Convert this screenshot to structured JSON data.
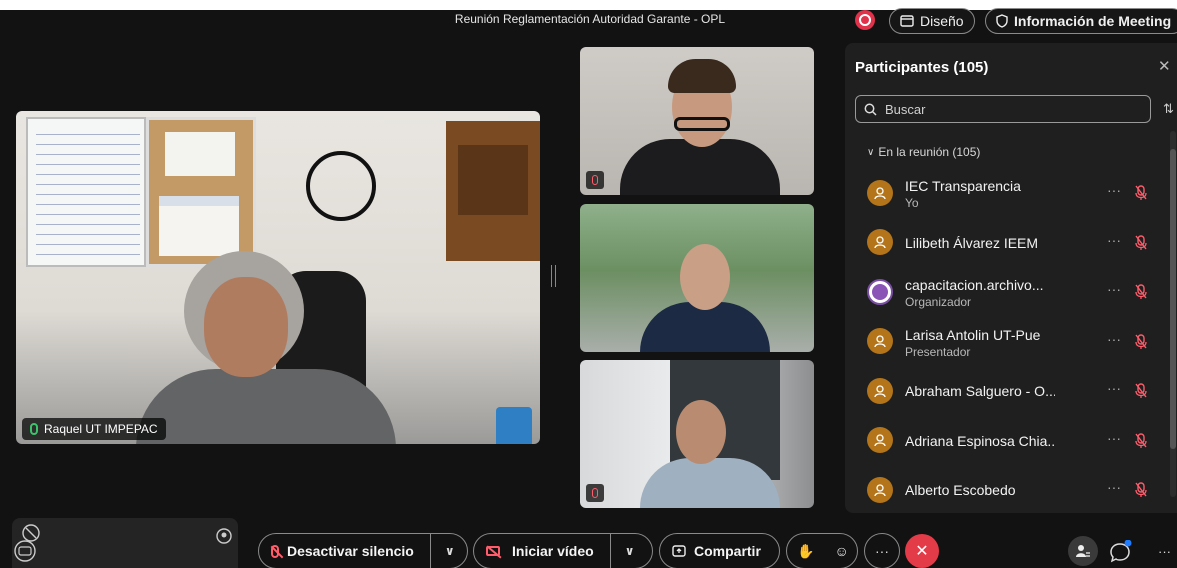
{
  "meeting": {
    "title": "Reunión Reglamentación Autoridad Garante - OPL"
  },
  "header": {
    "diseno_label": "Diseño",
    "info_label": "Información de Meeting",
    "record_color": "#e0324b"
  },
  "videos": {
    "main_name": "Raquel UT IMPEPAC"
  },
  "panel": {
    "title": "Participantes (105)",
    "search_placeholder": "Buscar",
    "section_label": "En la reunión (105)",
    "participants": [
      {
        "name": "IEC Transparencia",
        "role": "Yo",
        "avatar": "person-icon"
      },
      {
        "name": "Lilibeth Álvarez IEEM",
        "role": "",
        "avatar": "person-icon"
      },
      {
        "name": "capacitacion.archivo...",
        "role": "Organizador",
        "avatar": "profile-image"
      },
      {
        "name": "Larisa Antolin UT-Pue",
        "role": "Presentador",
        "avatar": "person-icon"
      },
      {
        "name": "Abraham Salguero - O...",
        "role": "",
        "avatar": "person-icon"
      },
      {
        "name": "Adriana Espinosa Chia...",
        "role": "",
        "avatar": "person-icon"
      },
      {
        "name": "Alberto Escobedo",
        "role": "",
        "avatar": "person-icon"
      }
    ]
  },
  "controls": {
    "unmute_label": "Desactivar silencio",
    "video_label": "Iniciar vídeo",
    "share_label": "Compartir",
    "more_label": "···",
    "leave_icon": "close-icon",
    "leave_color": "#e43b48"
  }
}
